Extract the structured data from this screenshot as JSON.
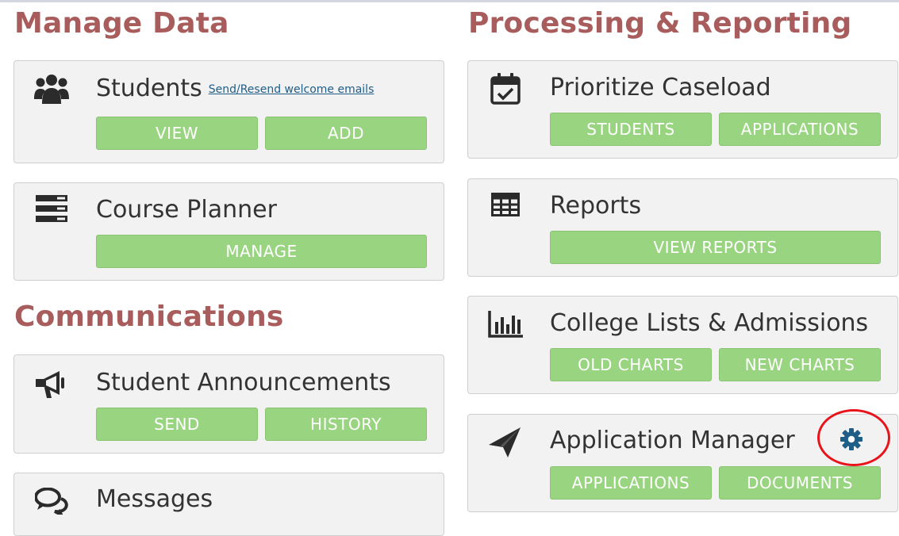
{
  "sections": {
    "manage_data": "Manage Data",
    "communications": "Communications",
    "processing_reporting": "Processing & Reporting"
  },
  "cards": {
    "students": {
      "title": "Students",
      "link": "Send/Resend welcome emails",
      "btn1": "VIEW",
      "btn2": "ADD",
      "icon": "users-icon"
    },
    "course_planner": {
      "title": "Course Planner",
      "btn1": "MANAGE",
      "icon": "server-list-icon"
    },
    "student_announcements": {
      "title": "Student Announcements",
      "btn1": "SEND",
      "btn2": "HISTORY",
      "icon": "megaphone-icon"
    },
    "messages": {
      "title": "Messages",
      "icon": "chat-bubbles-icon"
    },
    "prioritize_caseload": {
      "title": "Prioritize Caseload",
      "btn1": "STUDENTS",
      "btn2": "APPLICATIONS",
      "icon": "calendar-check-icon"
    },
    "reports": {
      "title": "Reports",
      "btn1": "VIEW REPORTS",
      "icon": "table-icon"
    },
    "college_lists": {
      "title": "College Lists & Admissions",
      "btn1": "OLD CHARTS",
      "btn2": "NEW CHARTS",
      "icon": "bar-chart-icon"
    },
    "application_manager": {
      "title": "Application Manager",
      "btn1": "APPLICATIONS",
      "btn2": "DOCUMENTS",
      "icon": "paper-plane-icon",
      "settings_icon": "gear-icon"
    }
  },
  "colors": {
    "section_title": "#a85c5c",
    "button": "#99d480",
    "card_bg": "#f2f2f2",
    "link": "#1f5e87",
    "gear": "#1f5e87",
    "annotation_circle": "#e8141c"
  }
}
